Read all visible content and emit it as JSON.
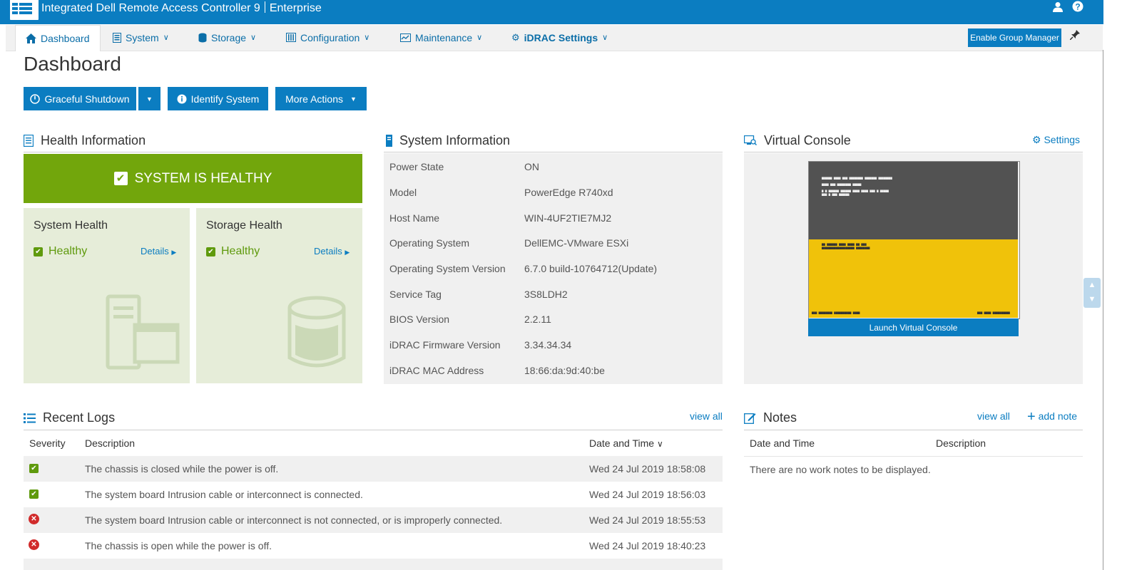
{
  "header": {
    "title": "Integrated Dell Remote Access Controller 9",
    "edition": "Enterprise"
  },
  "nav": {
    "items": [
      {
        "label": "Dashboard",
        "icon": "home-icon"
      },
      {
        "label": "System",
        "icon": "system-icon"
      },
      {
        "label": "Storage",
        "icon": "storage-icon"
      },
      {
        "label": "Configuration",
        "icon": "configuration-icon"
      },
      {
        "label": "Maintenance",
        "icon": "maintenance-icon"
      },
      {
        "label": "iDRAC Settings",
        "icon": "gears-icon"
      }
    ],
    "enable_group_manager": "Enable Group Manager"
  },
  "page": {
    "title": "Dashboard"
  },
  "actions": {
    "graceful_shutdown": "Graceful Shutdown",
    "identify_system": "Identify System",
    "more_actions": "More Actions"
  },
  "health": {
    "heading": "Health Information",
    "banner": "SYSTEM IS HEALTHY",
    "system": {
      "title": "System Health",
      "status": "Healthy",
      "details": "Details"
    },
    "storage": {
      "title": "Storage Health",
      "status": "Healthy",
      "details": "Details"
    }
  },
  "system_info": {
    "heading": "System Information",
    "rows": [
      {
        "label": "Power State",
        "value": "ON"
      },
      {
        "label": "Model",
        "value": "PowerEdge R740xd"
      },
      {
        "label": "Host Name",
        "value": "WIN-4UF2TIE7MJ2"
      },
      {
        "label": "Operating System",
        "value": "DellEMC-VMware ESXi"
      },
      {
        "label": "Operating System Version",
        "value": "6.7.0 build-10764712(Update)"
      },
      {
        "label": "Service Tag",
        "value": "3S8LDH2"
      },
      {
        "label": "BIOS Version",
        "value": "2.2.11"
      },
      {
        "label": "iDRAC Firmware Version",
        "value": "3.34.34.34"
      },
      {
        "label": "iDRAC MAC Address",
        "value": "18:66:da:9d:40:be"
      }
    ]
  },
  "virtual_console": {
    "heading": "Virtual Console",
    "settings": "Settings",
    "launch": "Launch Virtual Console"
  },
  "logs": {
    "heading": "Recent Logs",
    "view_all": "view all",
    "columns": [
      "Severity",
      "Description",
      "Date and Time"
    ],
    "rows": [
      {
        "severity": "ok",
        "description": "The chassis is closed while the power is off.",
        "datetime": "Wed 24 Jul 2019 18:58:08"
      },
      {
        "severity": "ok",
        "description": "The system board Intrusion cable or interconnect is connected.",
        "datetime": "Wed 24 Jul 2019 18:56:03"
      },
      {
        "severity": "error",
        "description": "The system board Intrusion cable or interconnect is not connected, or is improperly connected.",
        "datetime": "Wed 24 Jul 2019 18:55:53"
      },
      {
        "severity": "error",
        "description": "The chassis is open while the power is off.",
        "datetime": "Wed 24 Jul 2019 18:40:23"
      }
    ]
  },
  "notes": {
    "heading": "Notes",
    "view_all": "view all",
    "add_note": "add note",
    "columns": [
      "Date and Time",
      "Description"
    ],
    "empty": "There are no work notes to be displayed."
  },
  "colors": {
    "brand": "#0b7dc1",
    "healthy": "#72a60c",
    "health_card": "#e6edd9",
    "critical": "#d12b2b"
  }
}
